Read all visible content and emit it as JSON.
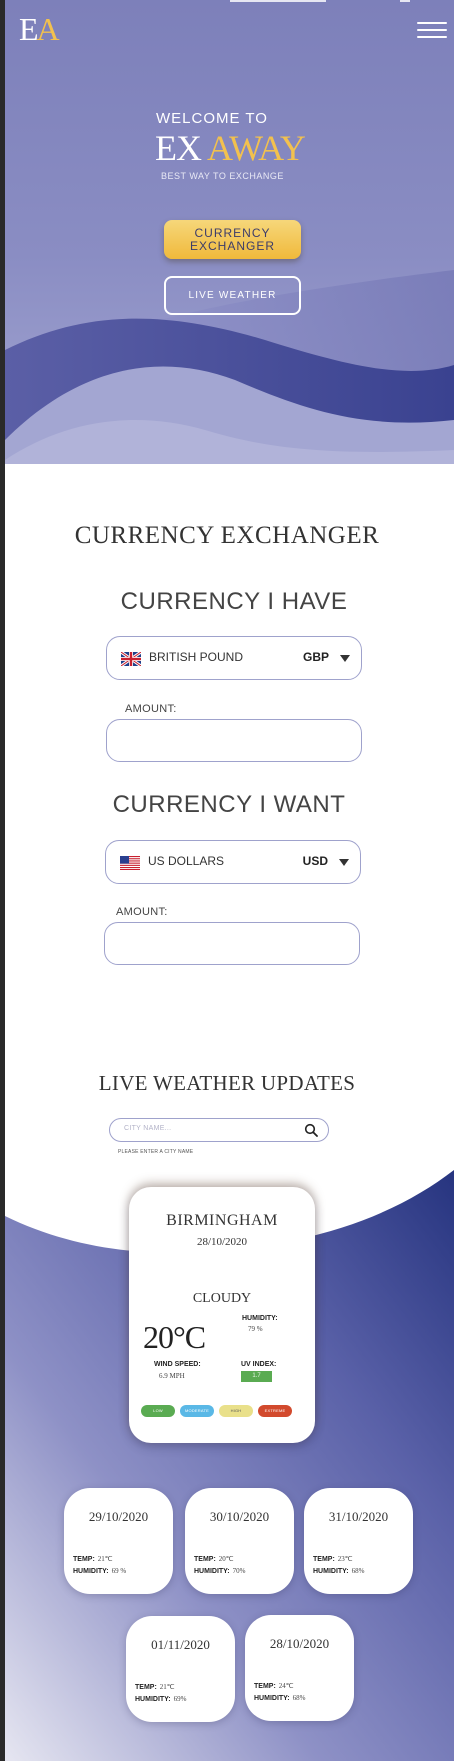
{
  "brand": {
    "logo_e": "E",
    "logo_a": "A",
    "welcome": "WELCOME TO",
    "name_ex": "EX",
    "name_away": "AWAY",
    "tagline": "BEST WAY TO EXCHANGE",
    "accent_color": "#f2c14e",
    "hero_color": "#8a8dc3"
  },
  "hero": {
    "currency_button": "CURRENCY EXCHANGER",
    "weather_button": "LIVE WEATHER"
  },
  "currency": {
    "title": "CURRENCY EXCHANGER",
    "have": {
      "title": "CURRENCY I HAVE",
      "selected_label": "BRITISH POUND",
      "selected_code": "GBP",
      "flag_icon": "uk-flag-icon",
      "amount_label": "AMOUNT:",
      "amount_value": ""
    },
    "want": {
      "title": "CURRENCY I WANT",
      "selected_label": "US DOLLARS",
      "selected_code": "USD",
      "flag_icon": "us-flag-icon",
      "amount_label": "AMOUNT:",
      "amount_value": ""
    }
  },
  "weather": {
    "title": "LIVE WEATHER UPDATES",
    "search_placeholder": "CITY NAME...",
    "search_icon": "search-icon",
    "hint": "PLEASE ENTER A CITY NAME",
    "current": {
      "city": "BIRMINGHAM",
      "date": "28/10/2020",
      "condition": "CLOUDY",
      "temperature": "20°C",
      "humidity_label": "HUMIDITY:",
      "humidity_value": "79 %",
      "wind_label": "WIND SPEED:",
      "wind_value": "6.9 MPH",
      "uv_label": "UV INDEX:",
      "uv_value": "1.7",
      "uv_scale": [
        {
          "label": "LOW",
          "color": "#5aab52"
        },
        {
          "label": "MODERATE",
          "color": "#5ab8e6"
        },
        {
          "label": "HIGH",
          "color": "#e9e08a"
        },
        {
          "label": "EXTREME",
          "color": "#d24a2d"
        }
      ]
    },
    "temp_label": "TEMP:",
    "humidity_label": "HUMIDITY:",
    "forecast": [
      {
        "date": "29/10/2020",
        "temp": "21℃",
        "humidity": "69 %"
      },
      {
        "date": "30/10/2020",
        "temp": "20℃",
        "humidity": "70%"
      },
      {
        "date": "31/10/2020",
        "temp": "23℃",
        "humidity": "68%"
      },
      {
        "date": "01/11/2020",
        "temp": "21℃",
        "humidity": "69%"
      },
      {
        "date": "28/10/2020",
        "temp": "24℃",
        "humidity": "68%"
      }
    ]
  }
}
